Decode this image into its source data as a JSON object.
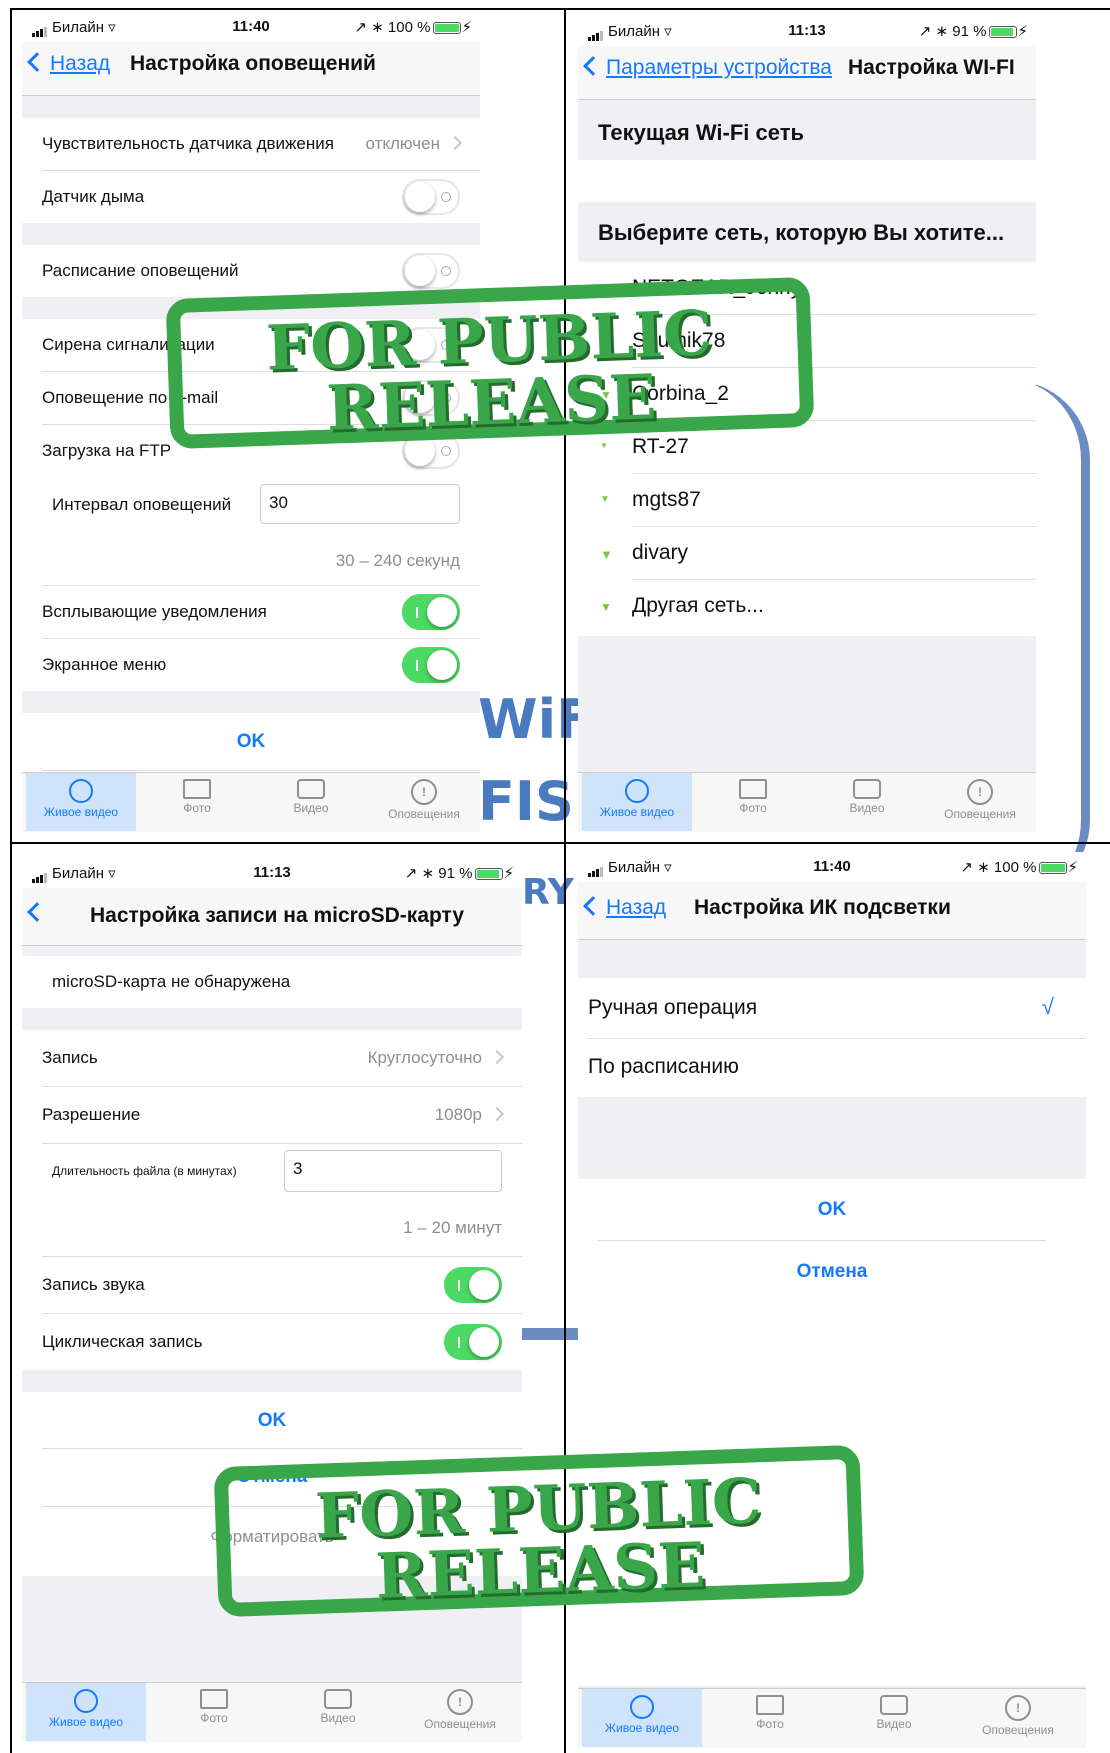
{
  "screen1": {
    "status": {
      "carrier": "Билайн",
      "time": "11:40",
      "battery": "100 %"
    },
    "back_label": "Назад",
    "title": "Настройка оповещений",
    "rows": {
      "motion": {
        "label": "Чувствительность датчика движения",
        "value": "отключен"
      },
      "smoke": {
        "label": "Датчик дыма"
      },
      "schedule": {
        "label": "Расписание оповещений"
      },
      "siren": {
        "label": "Сирена сигнализации"
      },
      "email": {
        "label": "Оповещение по e-mail"
      },
      "ftp": {
        "label": "Загрузка на FTP"
      },
      "interval": {
        "label": "Интервал оповещений",
        "value": "30",
        "hint": "30 – 240 секунд"
      },
      "popup": {
        "label": "Всплывающие  уведомления"
      },
      "osd": {
        "label": "Экранное меню"
      }
    },
    "ok_label": "OK"
  },
  "screen2": {
    "status": {
      "carrier": "Билайн",
      "time": "11:13",
      "battery": "91 %"
    },
    "back_label": "Параметры устройства",
    "title": "Настройка WI-FI",
    "current_header": "Текущая Wi-Fi сеть",
    "choose_header": "Выберите сеть, которую Вы хотите...",
    "networks": [
      "NETGEAR_Jenny",
      "Sputnik78",
      "Corbina_2",
      "RT-27",
      "mgts87",
      "divary",
      "Другая сеть..."
    ]
  },
  "screen3": {
    "status": {
      "carrier": "Билайн",
      "time": "11:13",
      "battery": "91 %"
    },
    "title": "Настройка записи на microSD-карту",
    "sd_status": "microSD-карта не обнаружена",
    "rows": {
      "record": {
        "label": "Запись",
        "value": "Круглосуточно"
      },
      "resolution": {
        "label": "Разрешение",
        "value": "1080p"
      },
      "duration": {
        "label": "Длительность файла (в минутах)",
        "value": "3",
        "hint": "1 – 20 минут"
      },
      "audio": {
        "label": "Запись звука"
      },
      "loop": {
        "label": "Циклическая запись"
      }
    },
    "ok_label": "OK",
    "cancel_label": "Отмена",
    "format_label": "Форматировать"
  },
  "screen4": {
    "status": {
      "carrier": "Билайн",
      "time": "11:40",
      "battery": "100 %"
    },
    "back_label": "Назад",
    "title": "Настройка ИК подсветки",
    "options": {
      "manual": "Ручная операция",
      "scheduled": "По расписанию"
    },
    "check_mark": "√",
    "ok_label": "OK",
    "cancel_label": "Отмена"
  },
  "tabbar": {
    "live": "Живое видео",
    "photo": "Фото",
    "video": "Видео",
    "alerts": "Оповещения"
  },
  "stamp": {
    "line1": "FOR PUBLIC",
    "line2": "RELEASE"
  },
  "watermark": {
    "w1": "WiFi",
    "w2": "FISE",
    "w3": "RY"
  },
  "colors": {
    "accent": "#1479ff",
    "switch_on": "#4cd964",
    "stamp": "#3aa64a",
    "watermark": "#4a7ac0"
  },
  "icons": [
    "signal-icon",
    "wifi-icon",
    "location-icon",
    "bluetooth-icon",
    "battery-icon",
    "charging-icon",
    "chevron-left-icon",
    "chevron-right-icon",
    "checkmark-icon",
    "live-video-icon",
    "photo-icon",
    "video-icon",
    "alert-icon"
  ]
}
